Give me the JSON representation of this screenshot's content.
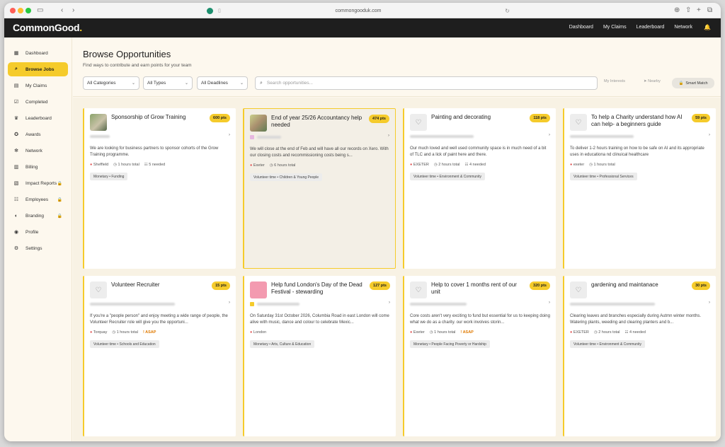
{
  "browser": {
    "url": "commongooduk.com"
  },
  "app": {
    "logo": "CommonGood",
    "logo_dot": "."
  },
  "topnav": [
    "Dashboard",
    "My Claims",
    "Leaderboard",
    "Network"
  ],
  "sidebar": {
    "items": [
      {
        "label": "Dashboard",
        "icon": "grid-icon"
      },
      {
        "label": "Browse Jobs",
        "icon": "search-icon"
      },
      {
        "label": "My Claims",
        "icon": "document-icon"
      },
      {
        "label": "Completed",
        "icon": "check-square-icon"
      },
      {
        "label": "Leaderboard",
        "icon": "trophy-icon"
      },
      {
        "label": "Awards",
        "icon": "award-icon"
      },
      {
        "label": "Network",
        "icon": "network-icon"
      },
      {
        "label": "Billing",
        "icon": "billing-icon"
      },
      {
        "label": "Impact Reports",
        "icon": "report-icon"
      },
      {
        "label": "Employees",
        "icon": "users-icon"
      },
      {
        "label": "Branding",
        "icon": "palette-icon"
      },
      {
        "label": "Profile",
        "icon": "user-circle-icon"
      },
      {
        "label": "Settings",
        "icon": "gear-icon"
      }
    ]
  },
  "page": {
    "title": "Browse Opportunities",
    "subtitle": "Find ways to contribute and earn points for your team"
  },
  "filters": {
    "category": "All Categories",
    "type": "All Types",
    "deadline": "All Deadlines",
    "search_placeholder": "Search opportunities...",
    "my_interests": "My Interests",
    "nearby": "Nearby",
    "smart_match": "Smart Match"
  },
  "cards": [
    {
      "title": "Sponsorship of Grow Training",
      "points": "600 pts",
      "description": "We are looking for business partners to sponsor cohorts of the Grow Training programme.",
      "location": "Sheffield",
      "hours": "1 hours total",
      "needed": "5 needed",
      "asap": "",
      "tag": "Monetary • Funding"
    },
    {
      "title": "End of year 25/26 Accountancy help needed",
      "points": "474 pts",
      "description": "We will close at the end of Feb and will have all our records on Xero. With our closing costs and recommissioning costs being s...",
      "location": "Exeter",
      "hours": "6 hours total",
      "needed": "",
      "asap": "",
      "tag": "Volunteer time • Children & Young People"
    },
    {
      "title": "Painting and decorating",
      "points": "118 pts",
      "description": "Our much loved and well used community space is in much need of a bit of TLC and a lick of paint here and there.",
      "location": "EXETER",
      "hours": "2 hours total",
      "needed": "4 needed",
      "asap": "",
      "tag": "Volunteer time • Environment & Community"
    },
    {
      "title": "To help a Charity understand how AI can help- a beginners guide",
      "points": "59 pts",
      "description": "To deliver 1-2 hours training on how to be safe on AI and its appropriate uses in educationa nd clinuical healthcare",
      "location": "exeter",
      "hours": "1 hours total",
      "needed": "",
      "asap": "",
      "tag": "Volunteer time • Professional Services"
    },
    {
      "title": "Volunteer Recruiter",
      "points": "15 pts",
      "description": "If you're a \"people person\" and enjoy meeting a wide range of people, the Volunteer Recruiter role will give you the opportuni...",
      "location": "Torquay",
      "hours": "1 hours total",
      "needed": "",
      "asap": "ASAP",
      "tag": "Volunteer time • Schools and Education"
    },
    {
      "title": "Help fund London's Day of the Dead Festival - stewarding",
      "points": "127 pts",
      "description": "On Saturday 31st October 2026, Columbia Road in east London will come alive with music, dance and colour to celebrate Mexic...",
      "location": "London",
      "hours": "",
      "needed": "",
      "asap": "",
      "tag": "Monetary • Arts, Culture & Education"
    },
    {
      "title": "Help to cover 1 months rent of our unit",
      "points": "320 pts",
      "description": "Core costs aren't very exciting to fund but essential for us to keeping doing what we do as a charity. our work involves storin...",
      "location": "Exeter",
      "hours": "1 hours total",
      "needed": "",
      "asap": "ASAP",
      "tag": "Monetary • People Facing Poverty or Hardship"
    },
    {
      "title": "gardening and maintanace",
      "points": "30 pts",
      "description": "Clearing leaves and branches especially during Autmn winter months. Watering plants, weeding and clearing planters and b...",
      "location": "EXETER",
      "hours": "2 hours total",
      "needed": "4 needed",
      "asap": "",
      "tag": "Volunteer time • Environment & Community"
    }
  ]
}
